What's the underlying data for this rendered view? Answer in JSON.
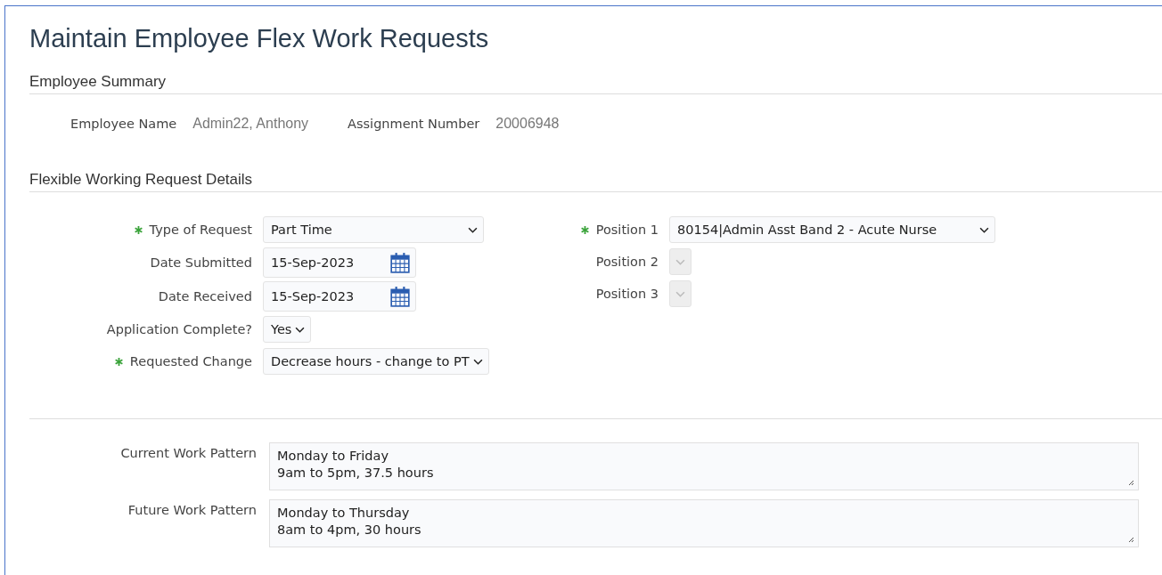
{
  "title": "Maintain Employee Flex Work Requests",
  "summary": {
    "heading": "Employee Summary",
    "items": [
      {
        "label": "Employee Name",
        "value": "Admin22, Anthony"
      },
      {
        "label": "Assignment Number",
        "value": "20006948"
      }
    ]
  },
  "details": {
    "heading": "Flexible Working Request Details",
    "left": [
      {
        "kind": "select",
        "label": "Type of Request",
        "required": true,
        "value": "Part Time"
      },
      {
        "kind": "date",
        "label": "Date Submitted",
        "required": false,
        "value": "15-Sep-2023"
      },
      {
        "kind": "date",
        "label": "Date Received",
        "required": false,
        "value": "15-Sep-2023"
      },
      {
        "kind": "select",
        "label": "Application Complete?",
        "required": false,
        "value": "Yes"
      },
      {
        "kind": "select",
        "label": "Requested Change",
        "required": true,
        "value": "Decrease hours - change to PT"
      }
    ],
    "right": [
      {
        "kind": "select",
        "label": "Position 1",
        "required": true,
        "value": "80154|Admin Asst Band 2 - Acute Nurse",
        "disabled": false
      },
      {
        "kind": "select",
        "label": "Position 2",
        "required": false,
        "disabled": true
      },
      {
        "kind": "select",
        "label": "Position 3",
        "required": false,
        "disabled": true
      }
    ]
  },
  "patterns": [
    {
      "label": "Current Work Pattern",
      "value": "Monday to Friday\n9am to 5pm, 37.5 hours"
    },
    {
      "label": "Future Work Pattern",
      "value": "Monday to Thursday\n8am to 4pm, 30 hours"
    }
  ]
}
